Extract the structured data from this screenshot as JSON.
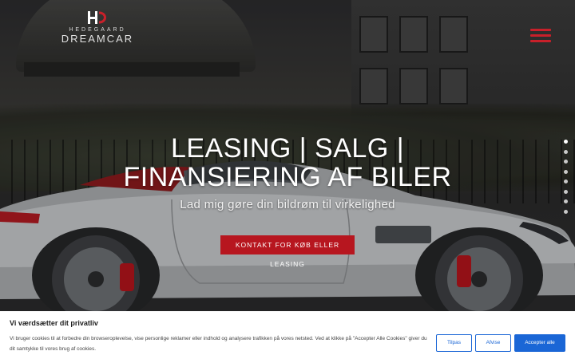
{
  "brand": {
    "mark": "HD",
    "sub": "HEDEGAARD",
    "name": "DREAMCAR"
  },
  "nav": {
    "menu_icon": "hamburger-icon"
  },
  "hero": {
    "headline": "LEASING | SALG | FINANSIERING AF BILER",
    "subline": "Lad mig gøre din bildrøm til virkelighed",
    "cta_label": "KONTAKT FOR KØB ELLER LEASING",
    "slides_count": 8
  },
  "cookie": {
    "title": "Vi værdsætter dit privatliv",
    "text": "Vi bruger cookies til at forbedre din browseroplevelse, vise personlige reklamer eller indhold og analysere trafikken på vores netsted. Ved at klikke på \"Accepter Alle Cookies\" giver du dit samtykke til vores brug af cookies.",
    "customize_label": "Tilpas",
    "reject_label": "Afvise",
    "accept_label": "Accepter alle"
  },
  "colors": {
    "accent": "#c8202a",
    "cta": "#b7161f",
    "cookie_button": "#1a66d6"
  }
}
